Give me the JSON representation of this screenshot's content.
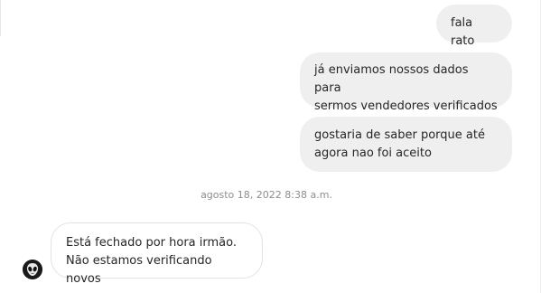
{
  "messages": [
    {
      "direction": "sent",
      "text": "fala rato"
    },
    {
      "direction": "sent",
      "text": "já enviamos nossos dados para\nsermos vendedores verificados"
    },
    {
      "direction": "sent",
      "text": "gostaria de saber porque até\nagora nao foi aceito"
    },
    {
      "direction": "received",
      "text": "Está fechado por hora irmão.\nNão estamos verificando novos"
    }
  ],
  "timestamp": "agosto 18, 2022 8:38 a.m.",
  "avatar": {
    "icon": "alien-head-icon"
  },
  "colors": {
    "sent_bubble": "#efefef",
    "received_bubble_border": "#e3e3e3",
    "timestamp": "#8e8e8e",
    "text": "#262626"
  }
}
